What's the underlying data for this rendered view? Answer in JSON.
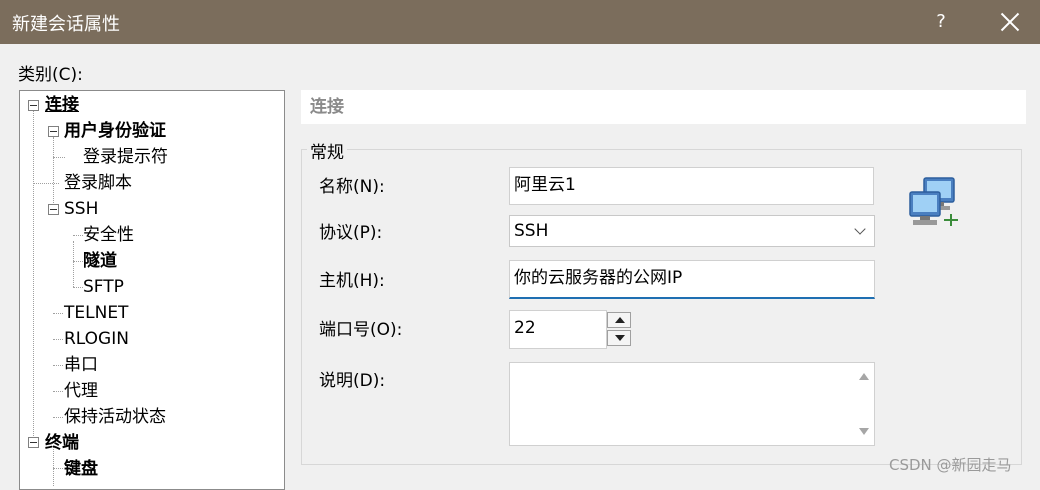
{
  "window": {
    "title": "新建会话属性",
    "help_label": "?"
  },
  "category": {
    "label": "类别(C):",
    "tree": [
      {
        "label": "连接",
        "bold": true,
        "underline": true
      },
      {
        "label": "用户身份验证",
        "bold": true
      },
      {
        "label": "登录提示符"
      },
      {
        "label": "登录脚本"
      },
      {
        "label": "SSH"
      },
      {
        "label": "安全性"
      },
      {
        "label": "隧道",
        "bold": true
      },
      {
        "label": "SFTP"
      },
      {
        "label": "TELNET"
      },
      {
        "label": "RLOGIN"
      },
      {
        "label": "串口"
      },
      {
        "label": "代理"
      },
      {
        "label": "保持活动状态"
      },
      {
        "label": "终端",
        "bold": true
      },
      {
        "label": "键盘",
        "bold": true
      }
    ]
  },
  "panel": {
    "header": "连接",
    "group_title": "常规",
    "fields": {
      "name_label": "名称(N):",
      "name_value": "阿里云1",
      "protocol_label": "协议(P):",
      "protocol_value": "SSH",
      "host_label": "主机(H):",
      "host_value": "你的云服务器的公网IP",
      "port_label": "端口号(O):",
      "port_value": "22",
      "desc_label": "说明(D):",
      "desc_value": ""
    }
  },
  "icons": {
    "network_icon": "network-computers-icon"
  },
  "watermark": "CSDN @新园走马",
  "colors": {
    "titlebar": "#7b6d5c",
    "accent": "#1f6fb2"
  }
}
